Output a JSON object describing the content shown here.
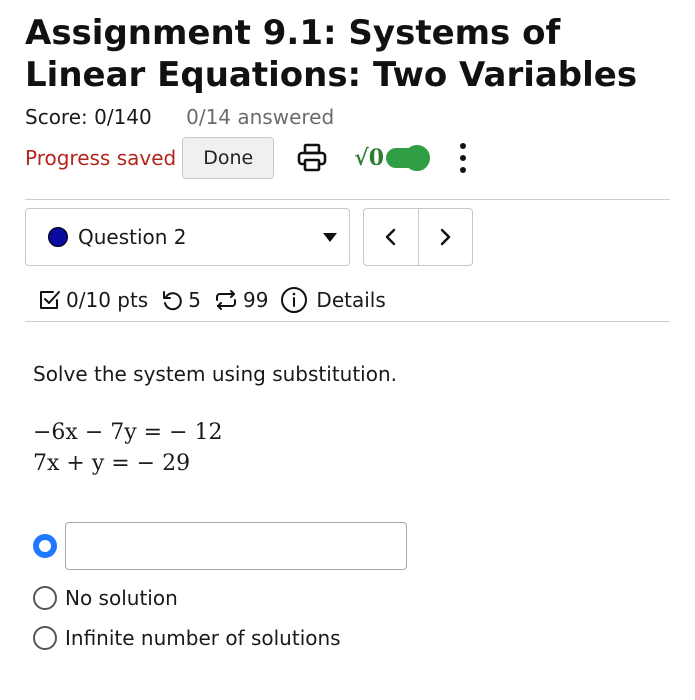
{
  "header": {
    "title": "Assignment 9.1: Systems of Linear Equations: Two Variables",
    "score": "Score: 0/140",
    "answered": "0/14 answered"
  },
  "toolbar": {
    "progress": "Progress saved",
    "done_label": "Done",
    "math_label": "√0",
    "math_toggle_on": true,
    "icons": [
      "print-icon",
      "math-toggle",
      "more-vertical-icon"
    ]
  },
  "question_nav": {
    "selected": "Question 2",
    "status_color": "#0a0a9e",
    "prev_icon": "chevron-left-icon",
    "next_icon": "chevron-right-icon"
  },
  "meta": {
    "points": "0/10 pts",
    "retries": "5",
    "attempts": "99",
    "details": "Details"
  },
  "question": {
    "prompt": "Solve the system using substitution.",
    "equations": [
      "−6x − 7y = − 12",
      "7x + y = − 29"
    ]
  },
  "options": [
    {
      "type": "input",
      "selected": true,
      "value": ""
    },
    {
      "label": "No solution",
      "selected": false
    },
    {
      "label": "Infinite number of solutions",
      "selected": false
    }
  ],
  "colors": {
    "progress_text": "#b3261e",
    "math_green": "#2e7d32",
    "toggle_green": "#2f9e44",
    "radio_selected": "#1f78ff"
  }
}
